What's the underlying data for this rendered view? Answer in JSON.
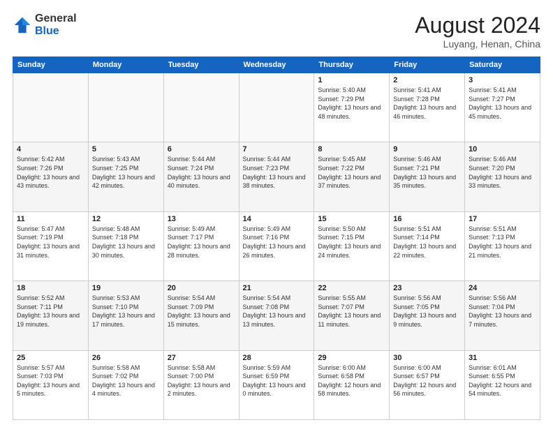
{
  "logo": {
    "general": "General",
    "blue": "Blue"
  },
  "header": {
    "month_year": "August 2024",
    "location": "Luyang, Henan, China"
  },
  "weekdays": [
    "Sunday",
    "Monday",
    "Tuesday",
    "Wednesday",
    "Thursday",
    "Friday",
    "Saturday"
  ],
  "weeks": [
    [
      {
        "day": "",
        "sunrise": "",
        "sunset": "",
        "daylight": ""
      },
      {
        "day": "",
        "sunrise": "",
        "sunset": "",
        "daylight": ""
      },
      {
        "day": "",
        "sunrise": "",
        "sunset": "",
        "daylight": ""
      },
      {
        "day": "",
        "sunrise": "",
        "sunset": "",
        "daylight": ""
      },
      {
        "day": "1",
        "sunrise": "Sunrise: 5:40 AM",
        "sunset": "Sunset: 7:29 PM",
        "daylight": "Daylight: 13 hours and 48 minutes."
      },
      {
        "day": "2",
        "sunrise": "Sunrise: 5:41 AM",
        "sunset": "Sunset: 7:28 PM",
        "daylight": "Daylight: 13 hours and 46 minutes."
      },
      {
        "day": "3",
        "sunrise": "Sunrise: 5:41 AM",
        "sunset": "Sunset: 7:27 PM",
        "daylight": "Daylight: 13 hours and 45 minutes."
      }
    ],
    [
      {
        "day": "4",
        "sunrise": "Sunrise: 5:42 AM",
        "sunset": "Sunset: 7:26 PM",
        "daylight": "Daylight: 13 hours and 43 minutes."
      },
      {
        "day": "5",
        "sunrise": "Sunrise: 5:43 AM",
        "sunset": "Sunset: 7:25 PM",
        "daylight": "Daylight: 13 hours and 42 minutes."
      },
      {
        "day": "6",
        "sunrise": "Sunrise: 5:44 AM",
        "sunset": "Sunset: 7:24 PM",
        "daylight": "Daylight: 13 hours and 40 minutes."
      },
      {
        "day": "7",
        "sunrise": "Sunrise: 5:44 AM",
        "sunset": "Sunset: 7:23 PM",
        "daylight": "Daylight: 13 hours and 38 minutes."
      },
      {
        "day": "8",
        "sunrise": "Sunrise: 5:45 AM",
        "sunset": "Sunset: 7:22 PM",
        "daylight": "Daylight: 13 hours and 37 minutes."
      },
      {
        "day": "9",
        "sunrise": "Sunrise: 5:46 AM",
        "sunset": "Sunset: 7:21 PM",
        "daylight": "Daylight: 13 hours and 35 minutes."
      },
      {
        "day": "10",
        "sunrise": "Sunrise: 5:46 AM",
        "sunset": "Sunset: 7:20 PM",
        "daylight": "Daylight: 13 hours and 33 minutes."
      }
    ],
    [
      {
        "day": "11",
        "sunrise": "Sunrise: 5:47 AM",
        "sunset": "Sunset: 7:19 PM",
        "daylight": "Daylight: 13 hours and 31 minutes."
      },
      {
        "day": "12",
        "sunrise": "Sunrise: 5:48 AM",
        "sunset": "Sunset: 7:18 PM",
        "daylight": "Daylight: 13 hours and 30 minutes."
      },
      {
        "day": "13",
        "sunrise": "Sunrise: 5:49 AM",
        "sunset": "Sunset: 7:17 PM",
        "daylight": "Daylight: 13 hours and 28 minutes."
      },
      {
        "day": "14",
        "sunrise": "Sunrise: 5:49 AM",
        "sunset": "Sunset: 7:16 PM",
        "daylight": "Daylight: 13 hours and 26 minutes."
      },
      {
        "day": "15",
        "sunrise": "Sunrise: 5:50 AM",
        "sunset": "Sunset: 7:15 PM",
        "daylight": "Daylight: 13 hours and 24 minutes."
      },
      {
        "day": "16",
        "sunrise": "Sunrise: 5:51 AM",
        "sunset": "Sunset: 7:14 PM",
        "daylight": "Daylight: 13 hours and 22 minutes."
      },
      {
        "day": "17",
        "sunrise": "Sunrise: 5:51 AM",
        "sunset": "Sunset: 7:13 PM",
        "daylight": "Daylight: 13 hours and 21 minutes."
      }
    ],
    [
      {
        "day": "18",
        "sunrise": "Sunrise: 5:52 AM",
        "sunset": "Sunset: 7:11 PM",
        "daylight": "Daylight: 13 hours and 19 minutes."
      },
      {
        "day": "19",
        "sunrise": "Sunrise: 5:53 AM",
        "sunset": "Sunset: 7:10 PM",
        "daylight": "Daylight: 13 hours and 17 minutes."
      },
      {
        "day": "20",
        "sunrise": "Sunrise: 5:54 AM",
        "sunset": "Sunset: 7:09 PM",
        "daylight": "Daylight: 13 hours and 15 minutes."
      },
      {
        "day": "21",
        "sunrise": "Sunrise: 5:54 AM",
        "sunset": "Sunset: 7:08 PM",
        "daylight": "Daylight: 13 hours and 13 minutes."
      },
      {
        "day": "22",
        "sunrise": "Sunrise: 5:55 AM",
        "sunset": "Sunset: 7:07 PM",
        "daylight": "Daylight: 13 hours and 11 minutes."
      },
      {
        "day": "23",
        "sunrise": "Sunrise: 5:56 AM",
        "sunset": "Sunset: 7:05 PM",
        "daylight": "Daylight: 13 hours and 9 minutes."
      },
      {
        "day": "24",
        "sunrise": "Sunrise: 5:56 AM",
        "sunset": "Sunset: 7:04 PM",
        "daylight": "Daylight: 13 hours and 7 minutes."
      }
    ],
    [
      {
        "day": "25",
        "sunrise": "Sunrise: 5:57 AM",
        "sunset": "Sunset: 7:03 PM",
        "daylight": "Daylight: 13 hours and 5 minutes."
      },
      {
        "day": "26",
        "sunrise": "Sunrise: 5:58 AM",
        "sunset": "Sunset: 7:02 PM",
        "daylight": "Daylight: 13 hours and 4 minutes."
      },
      {
        "day": "27",
        "sunrise": "Sunrise: 5:58 AM",
        "sunset": "Sunset: 7:00 PM",
        "daylight": "Daylight: 13 hours and 2 minutes."
      },
      {
        "day": "28",
        "sunrise": "Sunrise: 5:59 AM",
        "sunset": "Sunset: 6:59 PM",
        "daylight": "Daylight: 13 hours and 0 minutes."
      },
      {
        "day": "29",
        "sunrise": "Sunrise: 6:00 AM",
        "sunset": "Sunset: 6:58 PM",
        "daylight": "Daylight: 12 hours and 58 minutes."
      },
      {
        "day": "30",
        "sunrise": "Sunrise: 6:00 AM",
        "sunset": "Sunset: 6:57 PM",
        "daylight": "Daylight: 12 hours and 56 minutes."
      },
      {
        "day": "31",
        "sunrise": "Sunrise: 6:01 AM",
        "sunset": "Sunset: 6:55 PM",
        "daylight": "Daylight: 12 hours and 54 minutes."
      }
    ]
  ]
}
